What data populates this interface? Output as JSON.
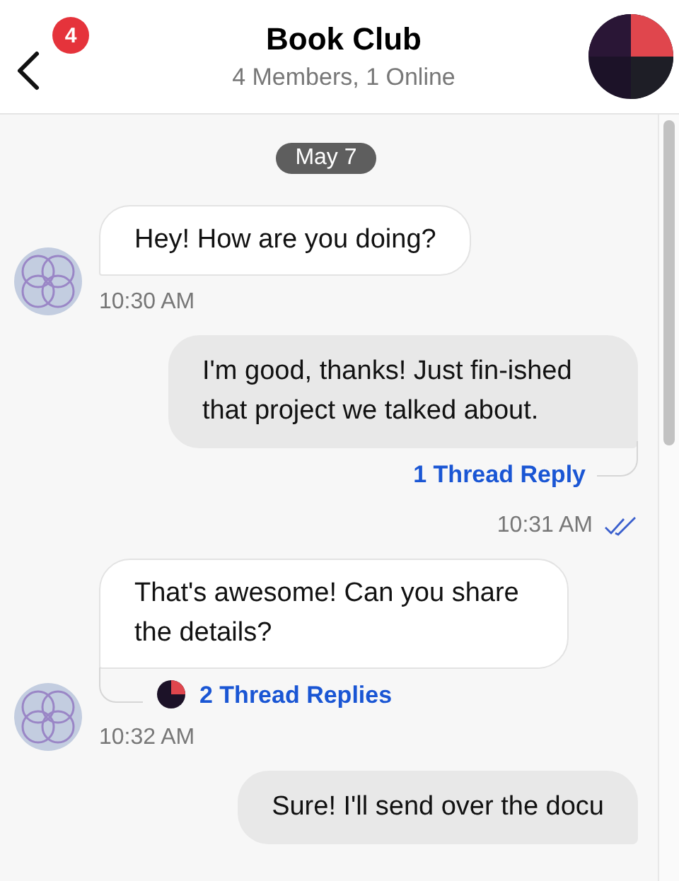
{
  "header": {
    "unread_badge": "4",
    "title": "Book Club",
    "subtitle": "4 Members, 1 Online"
  },
  "date_chip": "May 7",
  "messages": [
    {
      "kind": "incoming",
      "text": "Hey! How are you doing?",
      "time": "10:30 AM"
    },
    {
      "kind": "outgoing",
      "text": "I'm good, thanks! Just fin-ished that project we talked about.",
      "thread": "1 Thread Reply",
      "time": "10:31 AM",
      "read": true
    },
    {
      "kind": "incoming",
      "text": "That's awesome! Can you share the details?",
      "thread": "2 Thread Replies",
      "time": "10:32 AM"
    },
    {
      "kind": "outgoing",
      "text": "Sure! I'll send over the docu"
    }
  ]
}
